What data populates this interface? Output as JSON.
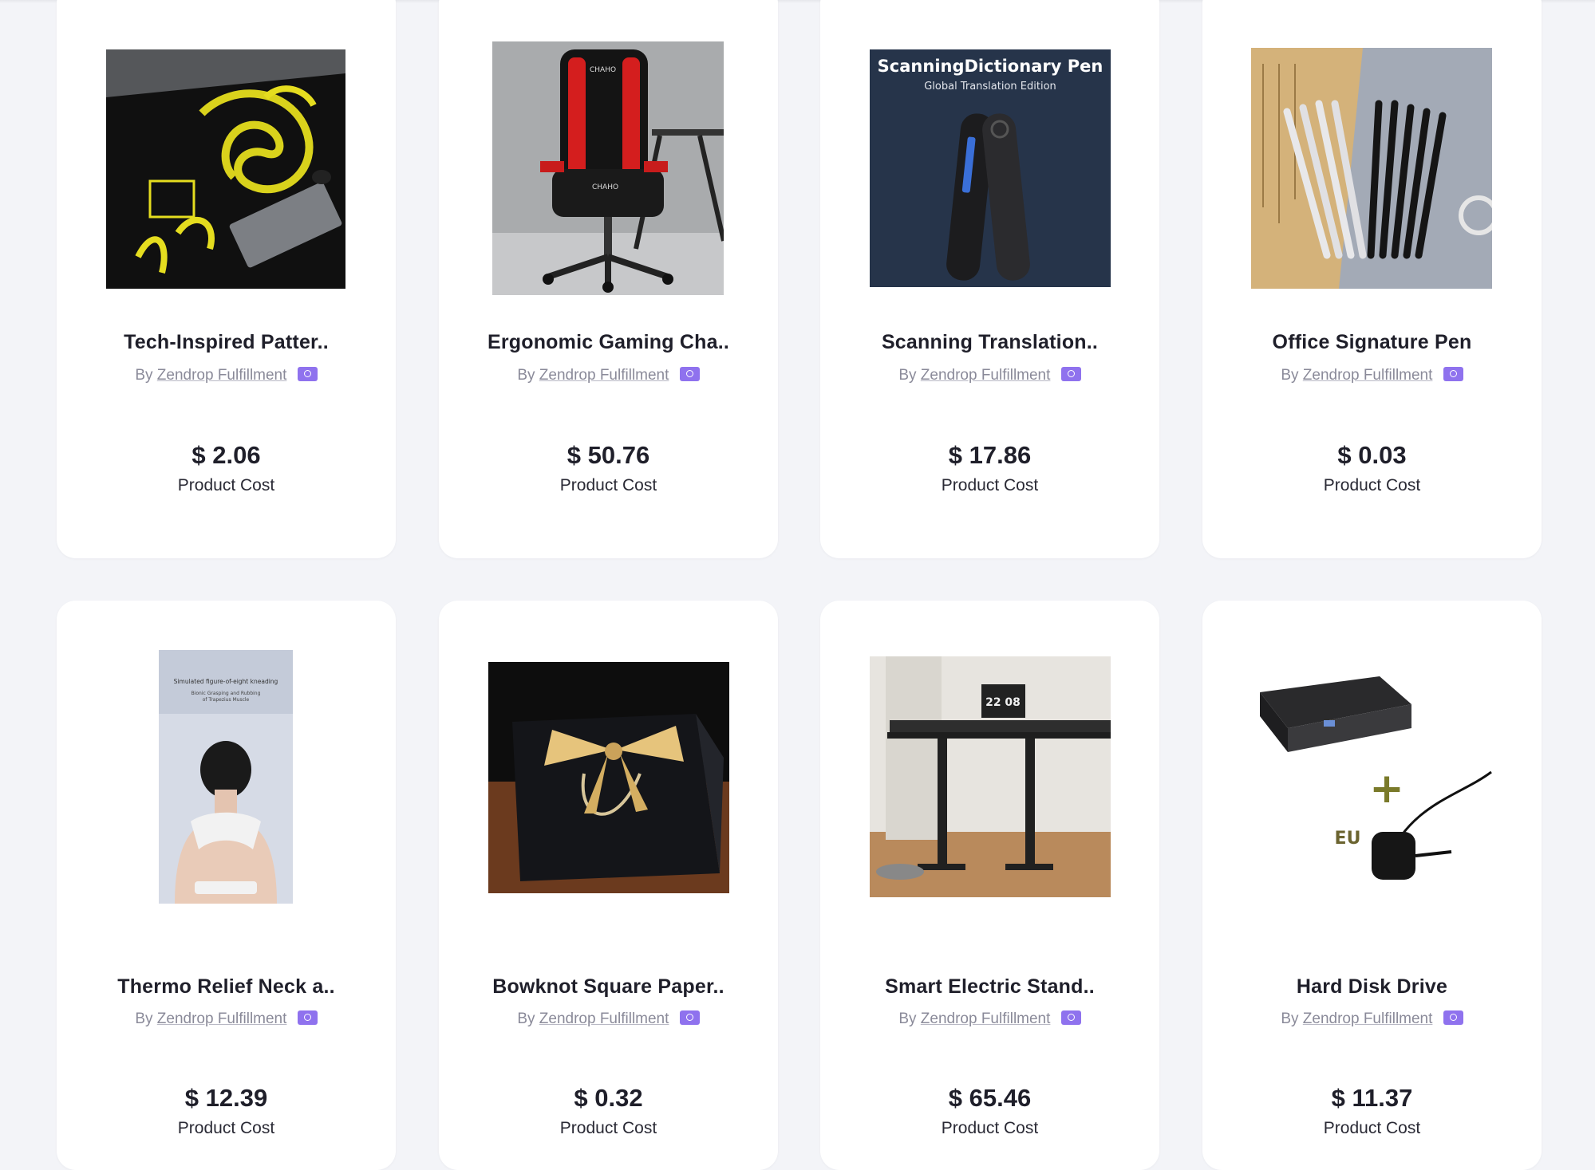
{
  "products": [
    {
      "name": "Tech-Inspired Patter..",
      "by": "By",
      "supplier": "Zendrop Fulfillment",
      "price": "$ 2.06",
      "cost_label": "Product Cost",
      "image": "dragon-desk-mat"
    },
    {
      "name": "Ergonomic Gaming Cha..",
      "by": "By",
      "supplier": "Zendrop Fulfillment",
      "price": "$ 50.76",
      "cost_label": "Product Cost",
      "image": "gaming-chair",
      "image_text": {
        "brand": "CHAHO"
      }
    },
    {
      "name": "Scanning Translation..",
      "by": "By",
      "supplier": "Zendrop Fulfillment",
      "price": "$ 17.86",
      "cost_label": "Product Cost",
      "image": "scanning-pen",
      "image_text": {
        "title": "ScanningDictionary Pen",
        "subtitle": "Global Translation Edition"
      }
    },
    {
      "name": "Office Signature Pen",
      "by": "By",
      "supplier": "Zendrop Fulfillment",
      "price": "$ 0.03",
      "cost_label": "Product Cost",
      "image": "signature-pens"
    },
    {
      "name": "Thermo Relief Neck a..",
      "by": "By",
      "supplier": "Zendrop Fulfillment",
      "price": "$ 12.39",
      "cost_label": "Product Cost",
      "image": "neck-massager",
      "image_text": {
        "line1": "Simulated figure-of-eight kneading",
        "line2": "Bionic Grasping and Rubbing",
        "line3": "of Trapezius Muscle"
      }
    },
    {
      "name": "Bowknot Square Paper..",
      "by": "By",
      "supplier": "Zendrop Fulfillment",
      "price": "$ 0.32",
      "cost_label": "Product Cost",
      "image": "gift-bag"
    },
    {
      "name": "Smart Electric Stand..",
      "by": "By",
      "supplier": "Zendrop Fulfillment",
      "price": "$ 65.46",
      "cost_label": "Product Cost",
      "image": "standing-desk",
      "image_text": {
        "clock": "22 08"
      }
    },
    {
      "name": "Hard Disk Drive",
      "by": "By",
      "supplier": "Zendrop Fulfillment",
      "price": "$ 11.37",
      "cost_label": "Product Cost",
      "image": "hard-disk-adapter",
      "image_text": {
        "plus": "+",
        "region": "EU"
      }
    }
  ],
  "colors": {
    "background": "#f3f4f8",
    "card": "#ffffff",
    "badge": "#8f72ee",
    "text": "#1f1f2a",
    "muted": "#8a8a99"
  },
  "icons": {
    "supplier_badge": "globe-icon"
  }
}
